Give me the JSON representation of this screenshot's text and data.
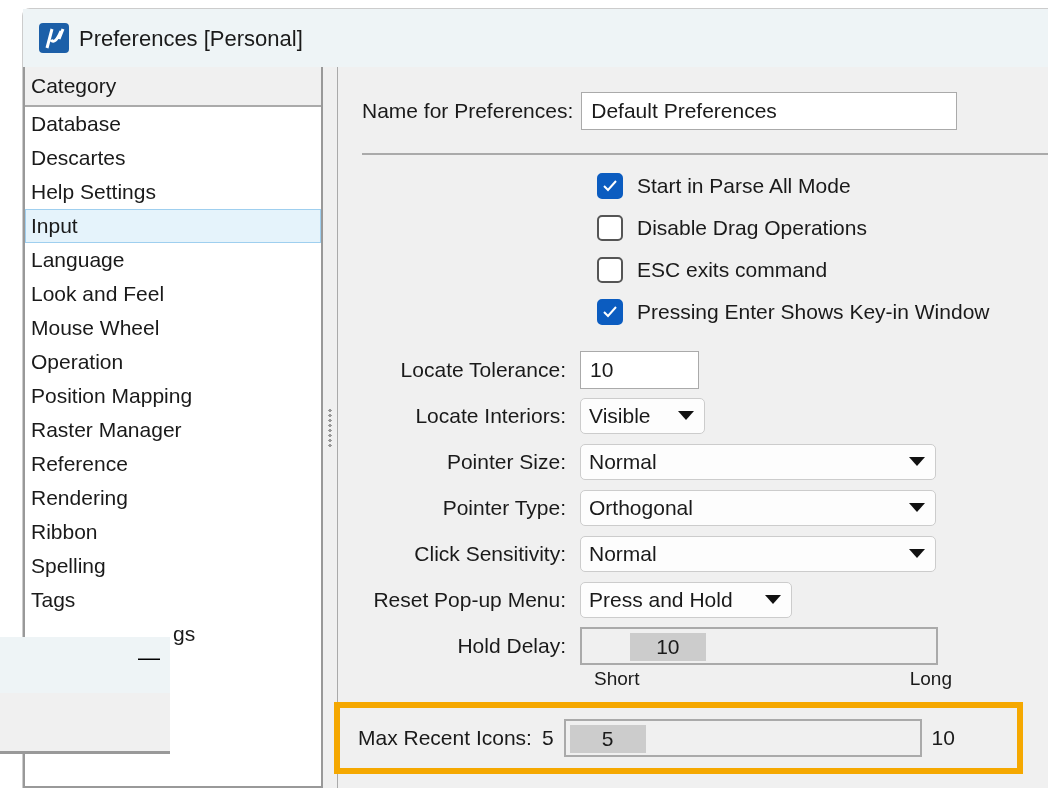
{
  "window": {
    "title": "Preferences [Personal]"
  },
  "category_list": {
    "header": "Category",
    "items": [
      {
        "label": "Database",
        "selected": false
      },
      {
        "label": "Descartes",
        "selected": false
      },
      {
        "label": "Help Settings",
        "selected": false
      },
      {
        "label": "Input",
        "selected": true
      },
      {
        "label": "Language",
        "selected": false
      },
      {
        "label": "Look and Feel",
        "selected": false
      },
      {
        "label": "Mouse Wheel",
        "selected": false
      },
      {
        "label": "Operation",
        "selected": false
      },
      {
        "label": "Position Mapping",
        "selected": false
      },
      {
        "label": "Raster Manager",
        "selected": false
      },
      {
        "label": "Reference",
        "selected": false
      },
      {
        "label": "Rendering",
        "selected": false
      },
      {
        "label": "Ribbon",
        "selected": false
      },
      {
        "label": "Spelling",
        "selected": false
      },
      {
        "label": "Tags",
        "selected": false
      },
      {
        "label": "gs",
        "selected": false
      }
    ]
  },
  "name_field": {
    "label": "Name for Preferences:",
    "value": "Default Preferences"
  },
  "checkboxes": [
    {
      "label": "Start in Parse All Mode",
      "checked": true
    },
    {
      "label": "Disable Drag Operations",
      "checked": false
    },
    {
      "label": "ESC exits command",
      "checked": false
    },
    {
      "label": "Pressing Enter Shows Key-in Window",
      "checked": true
    }
  ],
  "fields": [
    {
      "kind": "input",
      "label": "Locate Tolerance:",
      "value": "10"
    },
    {
      "kind": "dropdown",
      "label": "Locate Interiors:",
      "value": "Visible"
    },
    {
      "kind": "dropdown",
      "label": "Pointer Size:",
      "value": "Normal"
    },
    {
      "kind": "dropdown",
      "label": "Pointer Type:",
      "value": "Orthogonal"
    },
    {
      "kind": "dropdown",
      "label": "Click Sensitivity:",
      "value": "Normal"
    },
    {
      "kind": "dropdown",
      "label": "Reset Pop-up Menu:",
      "value": "Press and Hold"
    },
    {
      "kind": "slider",
      "label": "Hold Delay:",
      "value": "10",
      "level": 0.16
    }
  ],
  "hold_delay_scale": {
    "min_label": "Short",
    "max_label": "Long"
  },
  "max_recent_icons": {
    "label": "Max Recent Icons:",
    "min": "5",
    "value": "5",
    "max": "10",
    "level": 0,
    "highlighted": true
  },
  "overlay_window": {
    "button": "—"
  }
}
